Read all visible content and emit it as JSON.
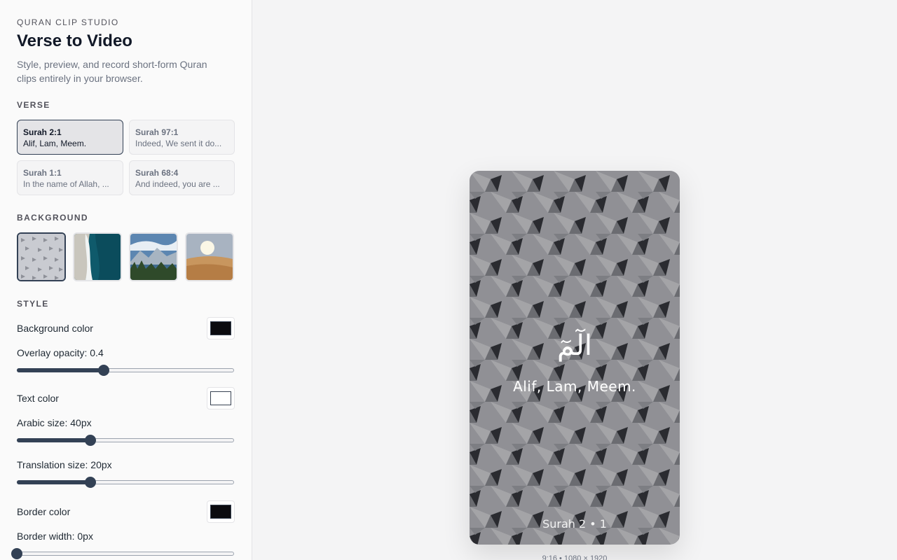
{
  "app": {
    "eyebrow": "QURAN CLIP STUDIO",
    "title": "Verse to Video",
    "subtitle": "Style, preview, and record short-form Quran clips entirely in your browser."
  },
  "verse": {
    "label": "VERSE",
    "items": [
      {
        "ref": "Surah 2:1",
        "snippet": "Alif, Lam, Meem.",
        "selected": true
      },
      {
        "ref": "Surah 97:1",
        "snippet": "Indeed, We sent it do...",
        "selected": false
      },
      {
        "ref": "Surah 1:1",
        "snippet": "In the name of Allah, ...",
        "selected": false
      },
      {
        "ref": "Surah 68:4",
        "snippet": "And indeed, you are ...",
        "selected": false
      }
    ]
  },
  "background": {
    "label": "BACKGROUND",
    "items": [
      {
        "name": "geometric-pattern",
        "selected": true
      },
      {
        "name": "ocean-shore",
        "selected": false
      },
      {
        "name": "mountain-lake",
        "selected": false
      },
      {
        "name": "desert-dunes",
        "selected": false
      }
    ]
  },
  "style": {
    "label": "STYLE",
    "background_color_label": "Background color",
    "background_color": "#0b0b0f",
    "overlay_opacity_label": "Overlay opacity: 0.4",
    "overlay_opacity": 0.4,
    "text_color_label": "Text color",
    "text_color": "#ffffff",
    "arabic_size_label": "Arabic size: 40px",
    "arabic_size_fraction": 0.34,
    "translation_size_label": "Translation size: 20px",
    "translation_size_fraction": 0.34,
    "border_color_label": "Border color",
    "border_color": "#0b0b0f",
    "border_width_label": "Border width: 0px",
    "border_width_fraction": 0.0
  },
  "preview": {
    "arabic": "الٓمٓ",
    "translation": "Alif, Lam, Meem.",
    "reference": "Surah 2 • 1",
    "caption": "9:16 • 1080 × 1920"
  },
  "colors": {
    "accent": "#334155",
    "panel": "#fafafa",
    "canvas": "#f4f4f5"
  }
}
